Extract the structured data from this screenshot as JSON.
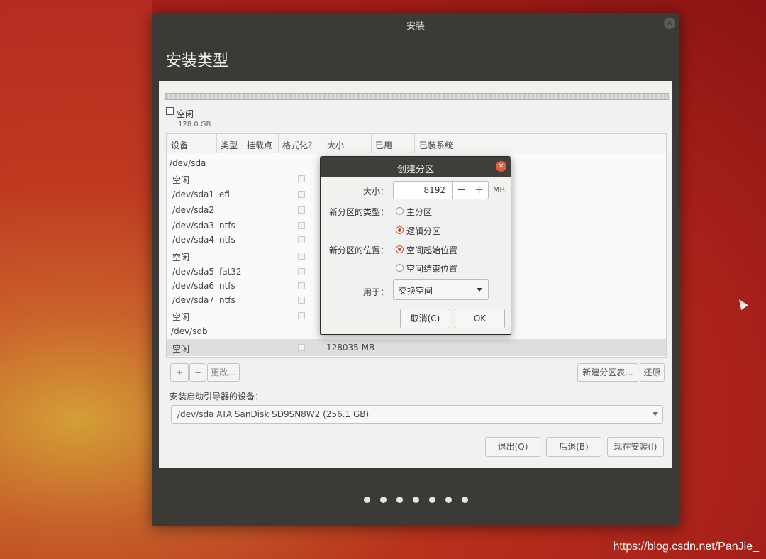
{
  "window": {
    "title": "安装",
    "heading": "安装类型"
  },
  "disk_legend": {
    "label": "空闲",
    "size": "128.0 GB"
  },
  "table": {
    "columns": [
      "设备",
      "类型",
      "挂载点",
      "格式化？",
      "大小",
      "已用",
      "已装系统"
    ],
    "rows": [
      {
        "device": "/dev/sda",
        "fs": "",
        "size": "",
        "group": true
      },
      {
        "device": "空闲",
        "fs": "",
        "size": ""
      },
      {
        "device": "/dev/sda1",
        "fs": "efi",
        "size": ""
      },
      {
        "device": "/dev/sda2",
        "fs": "",
        "size": ""
      },
      {
        "device": "/dev/sda3",
        "fs": "ntfs",
        "size": ""
      },
      {
        "device": "/dev/sda4",
        "fs": "ntfs",
        "size": ""
      },
      {
        "device": "空闲",
        "fs": "",
        "size": ""
      },
      {
        "device": "/dev/sda5",
        "fs": "fat32",
        "size": ""
      },
      {
        "device": "/dev/sda6",
        "fs": "ntfs",
        "size": ""
      },
      {
        "device": "/dev/sda7",
        "fs": "ntfs",
        "size": ""
      },
      {
        "device": "空闲",
        "fs": "",
        "size": ""
      },
      {
        "device": "/dev/sdb",
        "fs": "",
        "size": "",
        "group": true
      },
      {
        "device": "空闲",
        "fs": "",
        "size": "128035 MB",
        "selected": true
      }
    ]
  },
  "table_buttons": {
    "add": "+",
    "remove": "−",
    "change": "更改...",
    "new_table": "新建分区表...",
    "revert": "还原"
  },
  "bootloader": {
    "label": "安装启动引导器的设备：",
    "value": "/dev/sda    ATA SanDisk SD9SN8W2 (256.1 GB)"
  },
  "nav_buttons": {
    "quit": "退出(Q)",
    "back": "后退(B)",
    "install": "现在安装(I)"
  },
  "dialog": {
    "title": "创建分区",
    "size_label": "大小：",
    "size_value": "8192",
    "minus": "−",
    "plus": "+",
    "unit": "MB",
    "type_label": "新分区的类型：",
    "type_primary": "主分区",
    "type_logical": "逻辑分区",
    "location_label": "新分区的位置：",
    "loc_begin": "空间起始位置",
    "loc_end": "空间结束位置",
    "use_label": "用于：",
    "use_value": "交换空间",
    "cancel": "取消(C)",
    "ok": "OK",
    "selected_type": "逻辑分区",
    "selected_location": "空间起始位置"
  },
  "progress_steps": 7,
  "watermark": "https://blog.csdn.net/PanJie_",
  "colors": {
    "accent": "#d0532c",
    "titlebar": "#3b3a37"
  }
}
